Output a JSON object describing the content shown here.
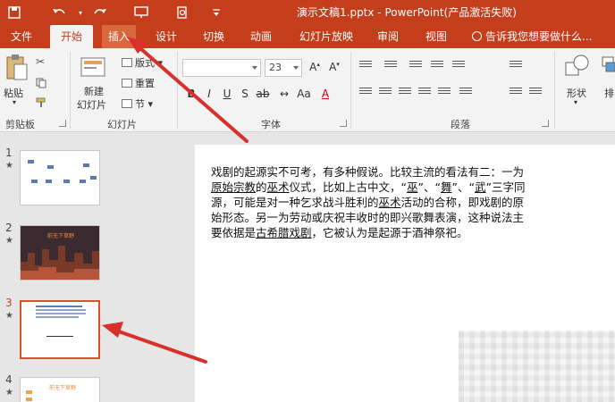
{
  "window": {
    "title": "演示文稿1.pptx - PowerPoint(产品激活失败)"
  },
  "tabs": [
    {
      "label": "文件"
    },
    {
      "label": "开始"
    },
    {
      "label": "插入"
    },
    {
      "label": "设计"
    },
    {
      "label": "切换"
    },
    {
      "label": "动画"
    },
    {
      "label": "幻灯片放映"
    },
    {
      "label": "审阅"
    },
    {
      "label": "视图"
    }
  ],
  "tell_me": "告诉我您想要做什么...",
  "ribbon": {
    "clipboard": {
      "paste": "粘贴",
      "group": "剪贴板"
    },
    "slides": {
      "new_line1": "新建",
      "new_line2": "幻灯片",
      "layout": "版式",
      "reset": "重置",
      "section": "节",
      "group": "幻灯片"
    },
    "font": {
      "size": "23",
      "group": "字体"
    },
    "paragraph": {
      "group": "段落"
    },
    "drawing": {
      "shape": "形状",
      "arrange": "排"
    }
  },
  "slides": [
    {
      "num": "1"
    },
    {
      "num": "2",
      "title": "前无下草野"
    },
    {
      "num": "3"
    },
    {
      "num": "4",
      "title": "前无下草野"
    }
  ],
  "content": {
    "s1": "戏剧的起源实不可考，有多种假说。比较主流的看法有二：一为",
    "u1": "原始宗教",
    "s2": "的",
    "u2": "巫术",
    "s3": "仪式，比如上古中文，“",
    "u3": "巫",
    "s4": "”、“",
    "u4": "舞",
    "s5": "”、“",
    "u5": "武",
    "s6": "”三字同源，可能是对一种乞求战斗胜利的",
    "u6": "巫术",
    "s7": "活动的合称，即戏剧的原始形态。另一为劳动或庆祝丰收时的即兴歌舞表演，这种说法主要依据是",
    "u7": "古希腊戏剧",
    "s8": "，它被认为是起源于酒神祭祀。"
  },
  "colors": {
    "accent": "#c43e1c",
    "arrow": "#d9302b"
  }
}
